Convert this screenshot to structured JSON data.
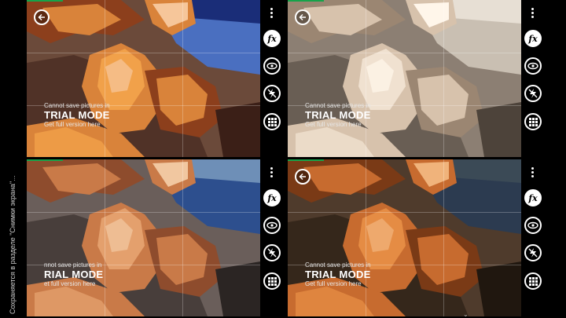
{
  "sidebar": {
    "caption": "Сохраняется в разделе \"Снимки экрана\"..."
  },
  "panels": [
    {
      "id": "top-left",
      "filter": "posterize",
      "progress": 0.14,
      "trial": {
        "line1": "Cannot save pictures in",
        "line2": "TRIAL MODE",
        "line3": "Get full version here"
      }
    },
    {
      "id": "top-right",
      "filter": "sepia",
      "progress": 0.14,
      "trial": {
        "line1": "Cannot save pictures in",
        "line2": "TRIAL MODE",
        "line3": "Get full version here"
      }
    },
    {
      "id": "bottom-left",
      "filter": "original",
      "progress": 0.14,
      "trial": {
        "line1": "nnot save pictures in",
        "line2": "RIAL MODE",
        "line3": "et full version here"
      }
    },
    {
      "id": "bottom-right",
      "filter": "warm",
      "progress": 0.14,
      "trial": {
        "line1": "Cannot save pictures in",
        "line2": "TRIAL MODE",
        "line3": "Get full version here"
      }
    }
  ],
  "toolbar": {
    "fx_label": "fx",
    "icons": [
      "menu-dots-icon",
      "fx-icon",
      "eye-icon",
      "flash-off-icon",
      "grid-icon",
      "back-arrow-icon"
    ]
  },
  "colors": {
    "progress": "#16a34a",
    "background": "#000000"
  }
}
